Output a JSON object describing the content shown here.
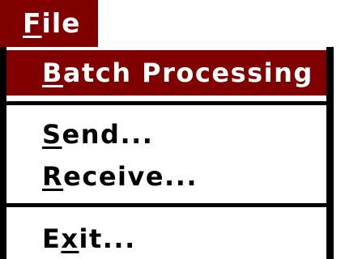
{
  "colors": {
    "highlight": "#800000",
    "highlight_text": "#ffffff",
    "text": "#000000",
    "background": "#ffffff"
  },
  "menubar": {
    "file": {
      "accel": "F",
      "rest": "ile"
    }
  },
  "file_menu": {
    "batch_processing": {
      "accel": "B",
      "rest": "atch Processing"
    },
    "send": {
      "accel": "S",
      "rest": "end..."
    },
    "receive": {
      "accel": "R",
      "rest": "eceive..."
    },
    "exit": {
      "before": "E",
      "accel": "x",
      "rest": "it..."
    }
  }
}
